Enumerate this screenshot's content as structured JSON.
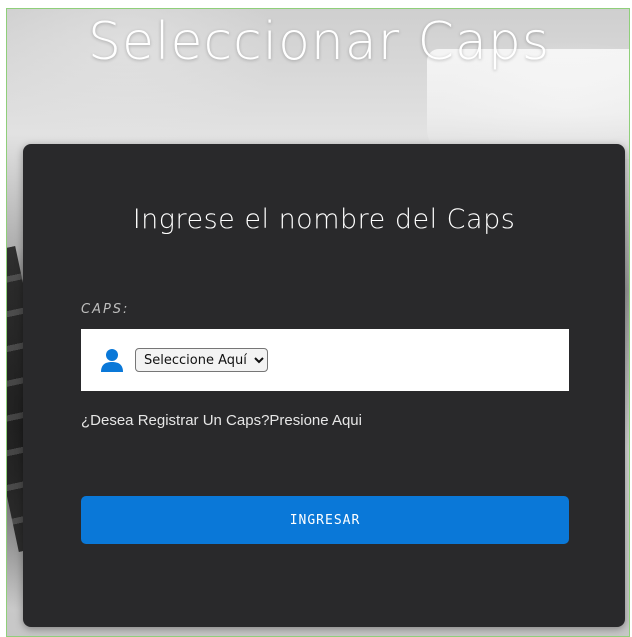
{
  "page": {
    "title": "Seleccionar Caps"
  },
  "card": {
    "heading": "Ingrese el nombre del Caps",
    "caps_label": "CAPS:",
    "select": {
      "selected": "Seleccione Aquí"
    },
    "register_link": "¿Desea Registrar Un Caps?Presione Aqui",
    "submit_label": "INGRESAR"
  },
  "icons": {
    "field_icon": "user-icon"
  },
  "colors": {
    "card_background": "#29292b",
    "button": "#0a78d8",
    "icon": "#0a78d8",
    "frame_border": "#8fcf7a"
  }
}
